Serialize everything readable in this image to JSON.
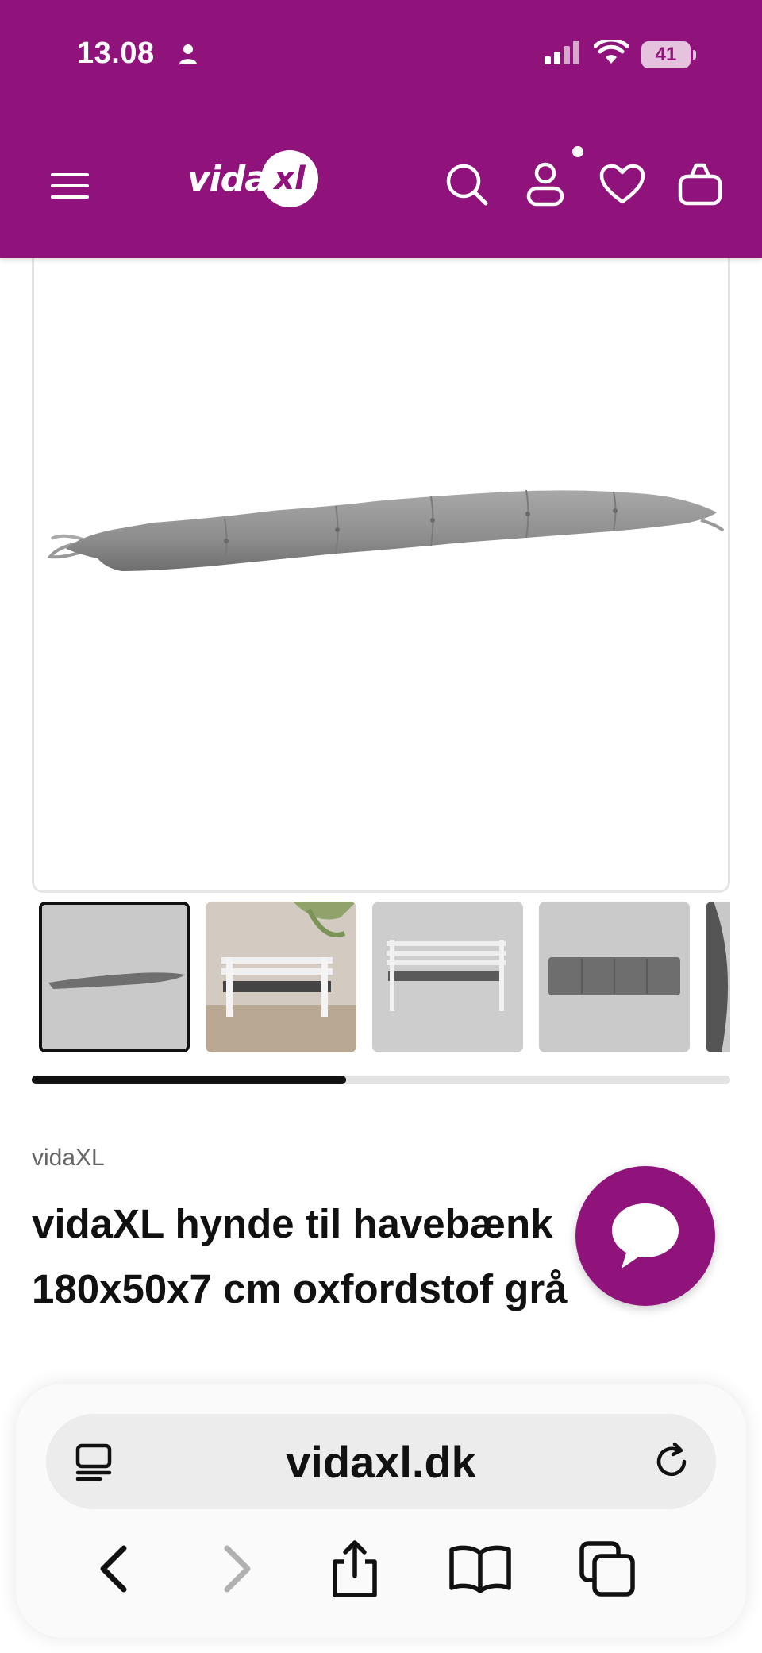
{
  "status_bar": {
    "time": "13.08",
    "battery": "41"
  },
  "header": {
    "logo_text": "vida",
    "logo_mark": "xl",
    "icons": [
      "menu-icon",
      "search-icon",
      "account-icon",
      "heart-icon",
      "basket-icon"
    ],
    "background_color": "#8f137a"
  },
  "gallery": {
    "thumbnails": [
      "cushion-front",
      "bench-garden-scene",
      "bench-with-cushion",
      "cushion-top-view",
      "cushion-detail"
    ],
    "selected_index": 0,
    "scroll_progress": 0.45
  },
  "product": {
    "brand": "vidaXL",
    "title_line1": "vidaXL hynde til havebænk",
    "title_line2": "180x50x7 cm oxfordstof grå"
  },
  "chat": {
    "icon": "chat-bubble-icon"
  },
  "browser": {
    "url": "vidaxl.dk",
    "icons": [
      "reader-icon",
      "reload-icon",
      "back-icon",
      "forward-icon",
      "share-icon",
      "bookmarks-icon",
      "tabs-icon"
    ]
  }
}
